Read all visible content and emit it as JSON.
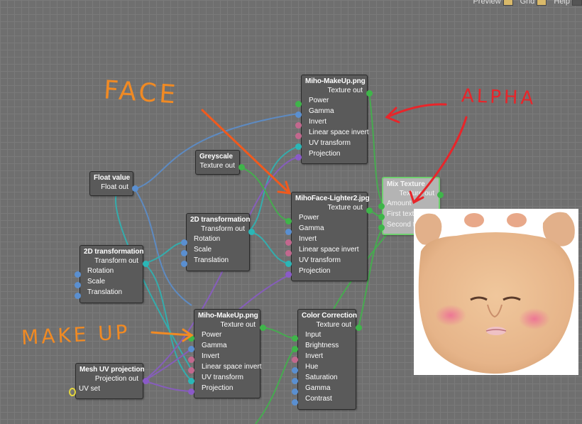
{
  "toolbar": {
    "preview_label": "Preview",
    "grid_label": "Grid",
    "help_label": "Help"
  },
  "nodes": {
    "miho_makeup_top": {
      "title": "Miho-MakeUp.png",
      "output": "Texture out",
      "inputs": [
        "Power",
        "Gamma",
        "Invert",
        "Linear space invert",
        "UV transform",
        "Projection"
      ]
    },
    "greyscale": {
      "title": "Greyscale",
      "output": "Texture out"
    },
    "float_value": {
      "title": "Float value",
      "output": "Float out"
    },
    "miho_face": {
      "title": "MihoFace-Lighter2.jpg",
      "output": "Texture out",
      "inputs": [
        "Power",
        "Gamma",
        "Invert",
        "Linear space invert",
        "UV transform",
        "Projection"
      ]
    },
    "mix_texture": {
      "title": "Mix Texture",
      "output": "Texture out",
      "inputs": [
        "Amount",
        "First texture",
        "Second texture"
      ]
    },
    "transform_2d_mid": {
      "title": "2D transformation",
      "output": "Transform out",
      "inputs": [
        "Rotation",
        "Scale",
        "Translation"
      ]
    },
    "transform_2d_left": {
      "title": "2D transformation",
      "output": "Transform out",
      "inputs": [
        "Rotation",
        "Scale",
        "Translation"
      ]
    },
    "miho_makeup_bottom": {
      "title": "Miho-MakeUp.png",
      "output": "Texture out",
      "inputs": [
        "Power",
        "Gamma",
        "Invert",
        "Linear space invert",
        "UV transform",
        "Projection"
      ]
    },
    "color_correction": {
      "title": "Color Correction",
      "output": "Texture out",
      "inputs": [
        "Input",
        "Brightness",
        "Invert",
        "Hue",
        "Saturation",
        "Gamma",
        "Contrast"
      ]
    },
    "mesh_uv": {
      "title": "Mesh UV projection",
      "output": "Projection out",
      "inputs": [
        "UV set"
      ]
    }
  },
  "annotations": {
    "face": "FACE",
    "alpha": "ALPHA",
    "makeup": "MAKE UP"
  },
  "colors": {
    "annotation_orange": "#f08a24",
    "annotation_red": "#e8252a",
    "socket_texture": "#3fb54a",
    "socket_float": "#5a8fd0",
    "socket_bool": "#c2688e",
    "socket_transform": "#2ab7b7",
    "socket_projection": "#8a5ac8",
    "selected_border": "#6fd06f"
  }
}
